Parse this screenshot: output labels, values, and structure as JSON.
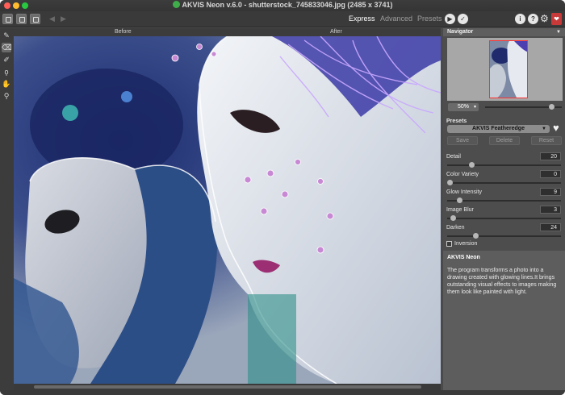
{
  "window": {
    "title": "AKVIS Neon v.6.0 - shutterstock_745833046.jpg (2485 x 3741)"
  },
  "toolbar": {
    "tool_icons": [
      "open-image-icon",
      "save-image-icon",
      "print-icon"
    ],
    "nav_arrows": [
      "back-arrow-icon",
      "forward-arrow-icon"
    ],
    "modes": [
      {
        "label": "Express",
        "active": true
      },
      {
        "label": "Advanced",
        "active": false
      },
      {
        "label": "Presets",
        "active": false
      }
    ],
    "actions": [
      {
        "icon": "run-icon",
        "glyph": "▶"
      },
      {
        "icon": "apply-check-icon",
        "glyph": "✓"
      }
    ],
    "right_icons": [
      {
        "icon": "info-icon",
        "glyph": "i"
      },
      {
        "icon": "help-icon",
        "glyph": "?"
      },
      {
        "icon": "gear-icon",
        "glyph": "⚙"
      },
      {
        "icon": "donate-icon",
        "glyph": "❤"
      }
    ]
  },
  "left_tools": [
    {
      "icon": "direction-brush-icon",
      "glyph": "✎"
    },
    {
      "icon": "eraser-icon",
      "glyph": "⌫"
    },
    {
      "icon": "history-brush-icon",
      "glyph": "✐"
    },
    {
      "icon": "lasso-icon",
      "glyph": "ϙ"
    },
    {
      "icon": "hand-icon",
      "glyph": "✋"
    },
    {
      "icon": "zoom-icon",
      "glyph": "⚲"
    }
  ],
  "canvas": {
    "before_label": "Before",
    "after_label": "After"
  },
  "navigator": {
    "title": "Navigator",
    "zoom": "50%",
    "zoom_fraction": 0.9
  },
  "presets": {
    "title": "Presets",
    "selected": "AKVIS Featheredge",
    "buttons": [
      "Save",
      "Delete",
      "Reset"
    ]
  },
  "params": [
    {
      "label": "Detail",
      "value": "20",
      "fraction": 0.2
    },
    {
      "label": "Color Variety",
      "value": "0",
      "fraction": 0.0
    },
    {
      "label": "Glow Intensity",
      "value": "9",
      "fraction": 0.09
    },
    {
      "label": "Image Blur",
      "value": "3",
      "fraction": 0.03
    },
    {
      "label": "Darken",
      "value": "24",
      "fraction": 0.24
    }
  ],
  "inversion": {
    "label": "Inversion",
    "checked": false
  },
  "info": {
    "title": "AKVIS Neon",
    "text": "The program transforms a photo into a drawing created with glowing lines.It brings outstanding visual effects to images making them look like painted with light."
  },
  "colors": {
    "accent_red": "#c83a3a",
    "panel_bg": "#4d4d4d"
  }
}
